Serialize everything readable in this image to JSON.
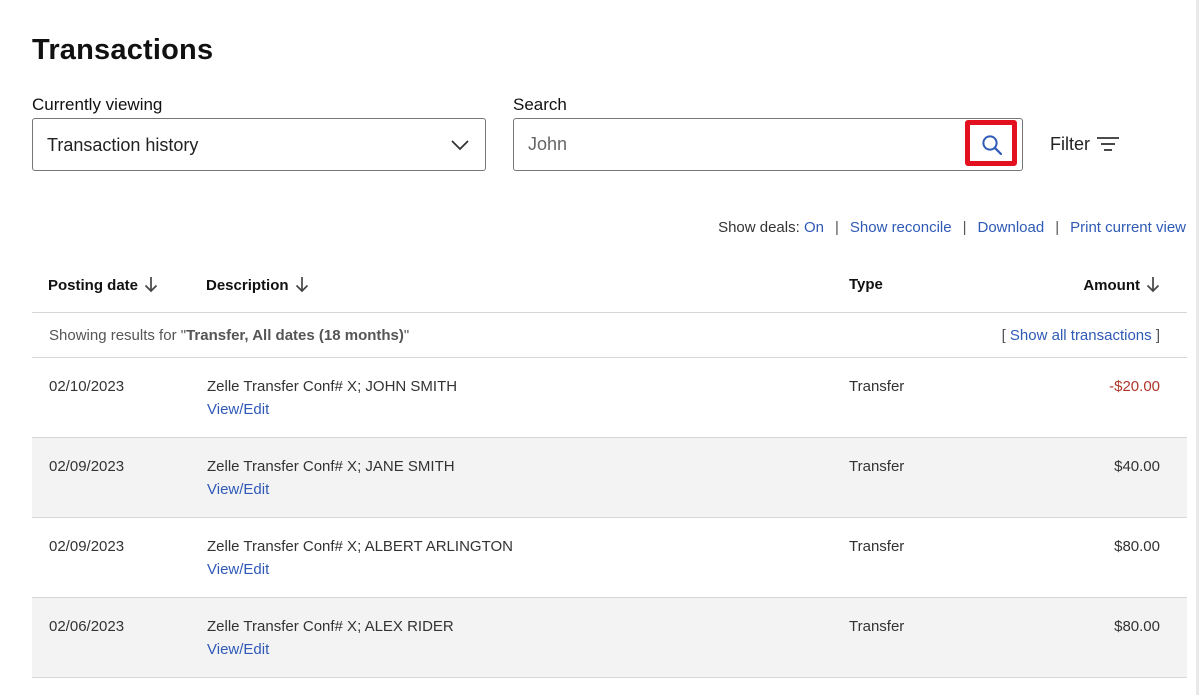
{
  "page": {
    "title": "Transactions"
  },
  "viewing": {
    "label": "Currently viewing",
    "value": "Transaction history"
  },
  "search": {
    "label": "Search",
    "value": "John"
  },
  "filter": {
    "label": "Filter"
  },
  "links": {
    "show_deals_label": "Show deals:",
    "show_deals_value": "On",
    "show_reconcile": "Show reconcile",
    "download": "Download",
    "print": "Print current view",
    "separator": "|"
  },
  "table": {
    "headers": {
      "posting_date": "Posting date",
      "description": "Description",
      "type": "Type",
      "amount": "Amount"
    },
    "notice": {
      "prefix": "Showing results for \"",
      "query": "Transfer, All dates (18 months)",
      "suffix": "\"",
      "show_all_open": "[ ",
      "show_all": "Show all transactions",
      "show_all_close": " ]"
    },
    "rows": [
      {
        "date": "02/10/2023",
        "description": "Zelle Transfer Conf# X; JOHN SMITH",
        "action": "View/Edit",
        "type": "Transfer",
        "amount": "-$20.00"
      },
      {
        "date": "02/09/2023",
        "description": "Zelle Transfer Conf# X; JANE SMITH",
        "action": "View/Edit",
        "type": "Transfer",
        "amount": "$40.00"
      },
      {
        "date": "02/09/2023",
        "description": "Zelle Transfer Conf# X; ALBERT ARLINGTON",
        "action": "View/Edit",
        "type": "Transfer",
        "amount": "$80.00"
      },
      {
        "date": "02/06/2023",
        "description": "Zelle Transfer Conf# X; ALEX RIDER",
        "action": "View/Edit",
        "type": "Transfer",
        "amount": "$80.00"
      }
    ]
  },
  "colors": {
    "link": "#2f5ab6",
    "negative": "#b0362a",
    "highlight_border": "#e3101f",
    "row_alt": "#f3f3f3"
  },
  "icons": {
    "dropdown": "chevron-down-icon",
    "search": "search-icon",
    "filter": "filter-icon",
    "sort": "arrow-down-icon"
  }
}
